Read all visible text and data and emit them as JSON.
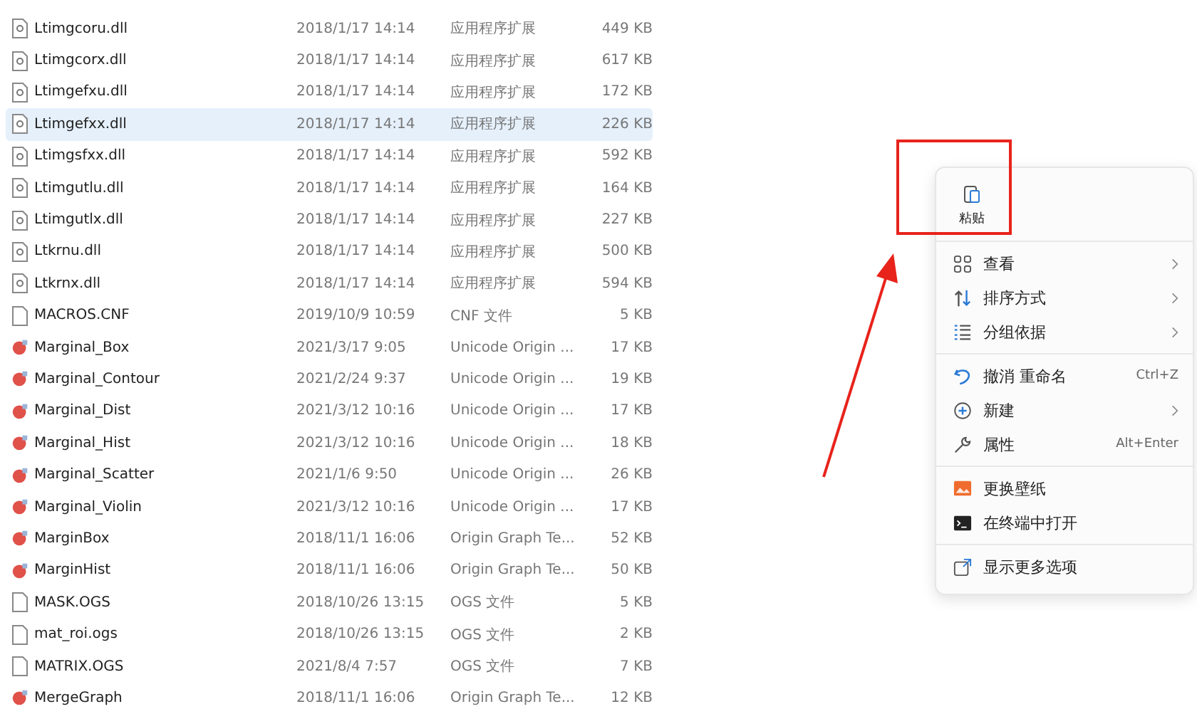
{
  "files": [
    {
      "name": "Ltimgcoru.dll",
      "date": "2018/1/17 14:14",
      "type": "应用程序扩展",
      "size": "449 KB",
      "kind": "dll",
      "selected": false
    },
    {
      "name": "Ltimgcorx.dll",
      "date": "2018/1/17 14:14",
      "type": "应用程序扩展",
      "size": "617 KB",
      "kind": "dll",
      "selected": false
    },
    {
      "name": "Ltimgefxu.dll",
      "date": "2018/1/17 14:14",
      "type": "应用程序扩展",
      "size": "172 KB",
      "kind": "dll",
      "selected": false
    },
    {
      "name": "Ltimgefxx.dll",
      "date": "2018/1/17 14:14",
      "type": "应用程序扩展",
      "size": "226 KB",
      "kind": "dll",
      "selected": true
    },
    {
      "name": "Ltimgsfxx.dll",
      "date": "2018/1/17 14:14",
      "type": "应用程序扩展",
      "size": "592 KB",
      "kind": "dll",
      "selected": false
    },
    {
      "name": "Ltimgutlu.dll",
      "date": "2018/1/17 14:14",
      "type": "应用程序扩展",
      "size": "164 KB",
      "kind": "dll",
      "selected": false
    },
    {
      "name": "Ltimgutlx.dll",
      "date": "2018/1/17 14:14",
      "type": "应用程序扩展",
      "size": "227 KB",
      "kind": "dll",
      "selected": false
    },
    {
      "name": "Ltkrnu.dll",
      "date": "2018/1/17 14:14",
      "type": "应用程序扩展",
      "size": "500 KB",
      "kind": "dll",
      "selected": false
    },
    {
      "name": "Ltkrnx.dll",
      "date": "2018/1/17 14:14",
      "type": "应用程序扩展",
      "size": "594 KB",
      "kind": "dll",
      "selected": false
    },
    {
      "name": "MACROS.CNF",
      "date": "2019/10/9 10:59",
      "type": "CNF 文件",
      "size": "5 KB",
      "kind": "file",
      "selected": false
    },
    {
      "name": "Marginal_Box",
      "date": "2021/3/17 9:05",
      "type": "Unicode Origin ...",
      "size": "17 KB",
      "kind": "origin",
      "selected": false
    },
    {
      "name": "Marginal_Contour",
      "date": "2021/2/24 9:37",
      "type": "Unicode Origin ...",
      "size": "19 KB",
      "kind": "origin",
      "selected": false
    },
    {
      "name": "Marginal_Dist",
      "date": "2021/3/12 10:16",
      "type": "Unicode Origin ...",
      "size": "17 KB",
      "kind": "origin",
      "selected": false
    },
    {
      "name": "Marginal_Hist",
      "date": "2021/3/12 10:16",
      "type": "Unicode Origin ...",
      "size": "18 KB",
      "kind": "origin",
      "selected": false
    },
    {
      "name": "Marginal_Scatter",
      "date": "2021/1/6 9:50",
      "type": "Unicode Origin ...",
      "size": "26 KB",
      "kind": "origin",
      "selected": false
    },
    {
      "name": "Marginal_Violin",
      "date": "2021/3/12 10:16",
      "type": "Unicode Origin ...",
      "size": "17 KB",
      "kind": "origin",
      "selected": false
    },
    {
      "name": "MarginBox",
      "date": "2018/11/1 16:06",
      "type": "Origin Graph Te...",
      "size": "52 KB",
      "kind": "origin",
      "selected": false
    },
    {
      "name": "MarginHist",
      "date": "2018/11/1 16:06",
      "type": "Origin Graph Te...",
      "size": "50 KB",
      "kind": "origin",
      "selected": false
    },
    {
      "name": "MASK.OGS",
      "date": "2018/10/26 13:15",
      "type": "OGS 文件",
      "size": "5 KB",
      "kind": "file",
      "selected": false
    },
    {
      "name": "mat_roi.ogs",
      "date": "2018/10/26 13:15",
      "type": "OGS 文件",
      "size": "2 KB",
      "kind": "file",
      "selected": false
    },
    {
      "name": "MATRIX.OGS",
      "date": "2021/8/4 7:57",
      "type": "OGS 文件",
      "size": "7 KB",
      "kind": "file",
      "selected": false
    },
    {
      "name": "MergeGraph",
      "date": "2018/11/1 16:06",
      "type": "Origin Graph Te...",
      "size": "12 KB",
      "kind": "origin",
      "selected": false
    }
  ],
  "context_menu": {
    "paste": "粘贴",
    "groups": [
      [
        {
          "label": "查看",
          "kind": "grid",
          "submenu": true
        },
        {
          "label": "排序方式",
          "kind": "sort",
          "submenu": true
        },
        {
          "label": "分组依据",
          "kind": "group",
          "submenu": true
        }
      ],
      [
        {
          "label": "撤消 重命名",
          "kind": "undo",
          "shortcut": "Ctrl+Z"
        },
        {
          "label": "新建",
          "kind": "new",
          "submenu": true
        },
        {
          "label": "属性",
          "kind": "wrench",
          "shortcut": "Alt+Enter"
        }
      ],
      [
        {
          "label": "更换壁纸",
          "kind": "wallpaper"
        },
        {
          "label": "在终端中打开",
          "kind": "terminal"
        }
      ],
      [
        {
          "label": "显示更多选项",
          "kind": "more"
        }
      ]
    ]
  }
}
